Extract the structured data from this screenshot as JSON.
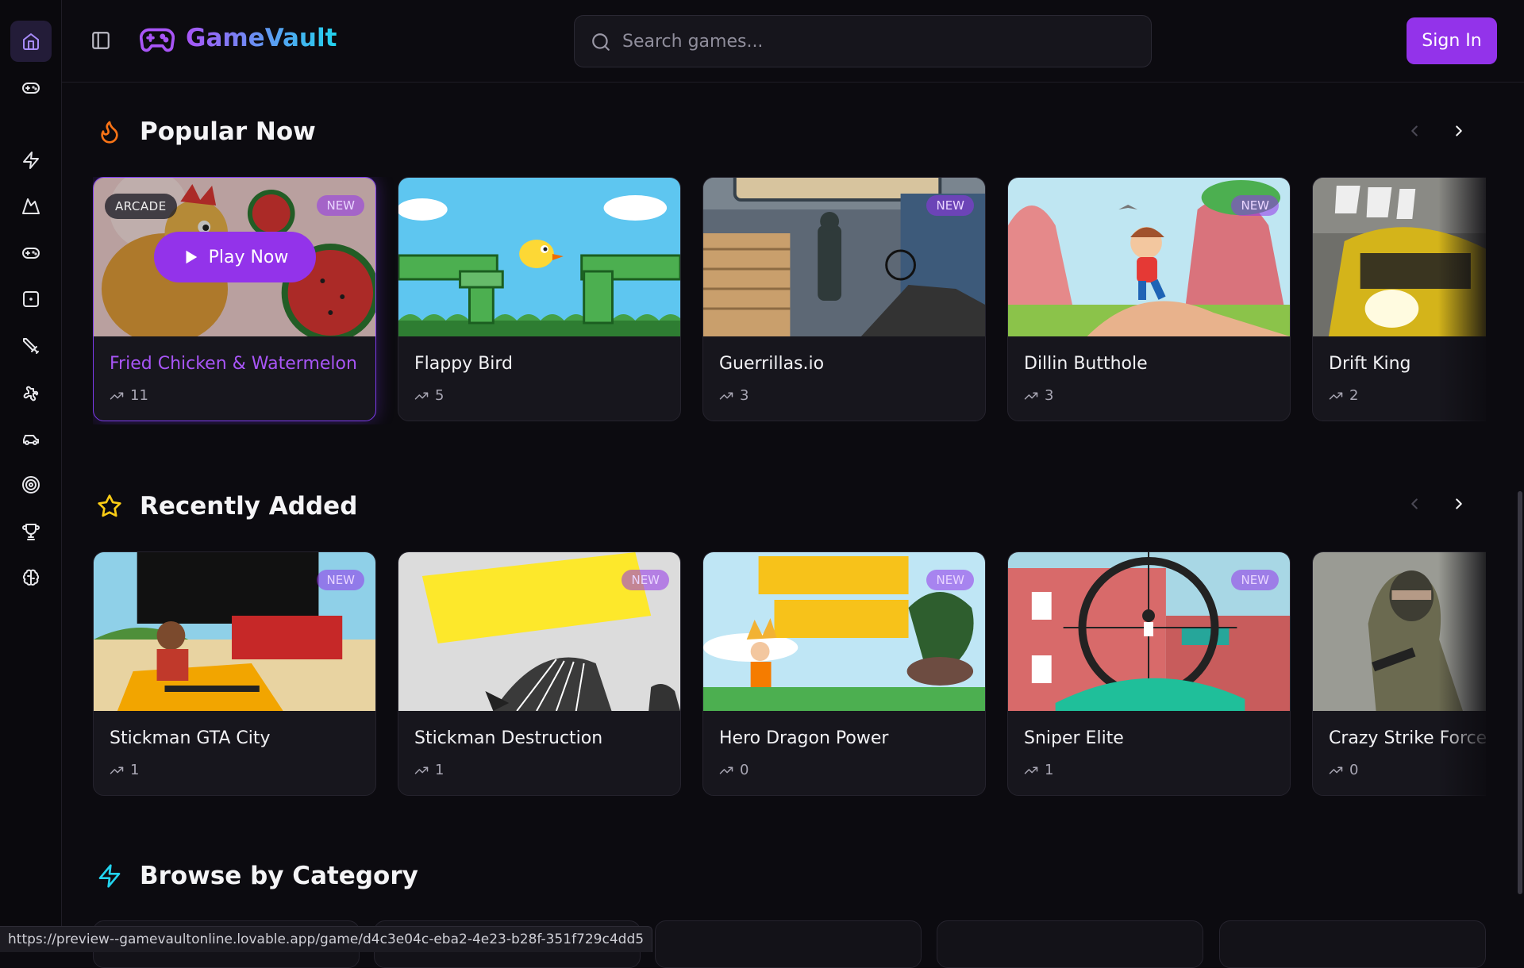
{
  "sidebar": {
    "items": [
      {
        "icon": "home-icon",
        "active": true
      },
      {
        "icon": "gamepad-icon"
      },
      {
        "icon": "zap-icon"
      },
      {
        "icon": "mountain-icon"
      },
      {
        "icon": "gamepad-icon"
      },
      {
        "icon": "dice-icon"
      },
      {
        "icon": "sword-icon"
      },
      {
        "icon": "puzzle-icon"
      },
      {
        "icon": "car-icon"
      },
      {
        "icon": "target-icon"
      },
      {
        "icon": "trophy-icon"
      },
      {
        "icon": "brain-icon"
      }
    ]
  },
  "header": {
    "brand": "GameVault",
    "search_placeholder": "Search games...",
    "sign_in": "Sign In"
  },
  "sections": {
    "popular": {
      "title": "Popular Now",
      "games": [
        {
          "title": "Fried Chicken & Watermelon",
          "plays": "11",
          "badge": "NEW",
          "category": "ARCADE",
          "play_label": "Play Now"
        },
        {
          "title": "Flappy Bird",
          "plays": "5"
        },
        {
          "title": "Guerrillas.io",
          "plays": "3",
          "badge": "NEW"
        },
        {
          "title": "Dillin Butthole",
          "plays": "3",
          "badge": "NEW"
        },
        {
          "title": "Drift King",
          "plays": "2"
        }
      ]
    },
    "recent": {
      "title": "Recently Added",
      "games": [
        {
          "title": "Stickman GTA City",
          "plays": "1",
          "badge": "NEW"
        },
        {
          "title": "Stickman Destruction",
          "plays": "1",
          "badge": "NEW"
        },
        {
          "title": "Hero Dragon Power",
          "plays": "0",
          "badge": "NEW"
        },
        {
          "title": "Sniper Elite",
          "plays": "1",
          "badge": "NEW"
        },
        {
          "title": "Crazy Strike Force",
          "plays": "0"
        }
      ]
    },
    "categories": {
      "title": "Browse by Category"
    }
  },
  "status_bar": {
    "url": "https://preview--gamevaultonline.lovable.app/game/d4c3e04c-eba2-4e23-b28f-351f729c4dd5"
  },
  "colors": {
    "accent": "#9333ea",
    "background": "#0c0b10",
    "card": "#17161d",
    "fire": "#f97316",
    "star": "#facc15",
    "zap": "#22d3ee"
  }
}
